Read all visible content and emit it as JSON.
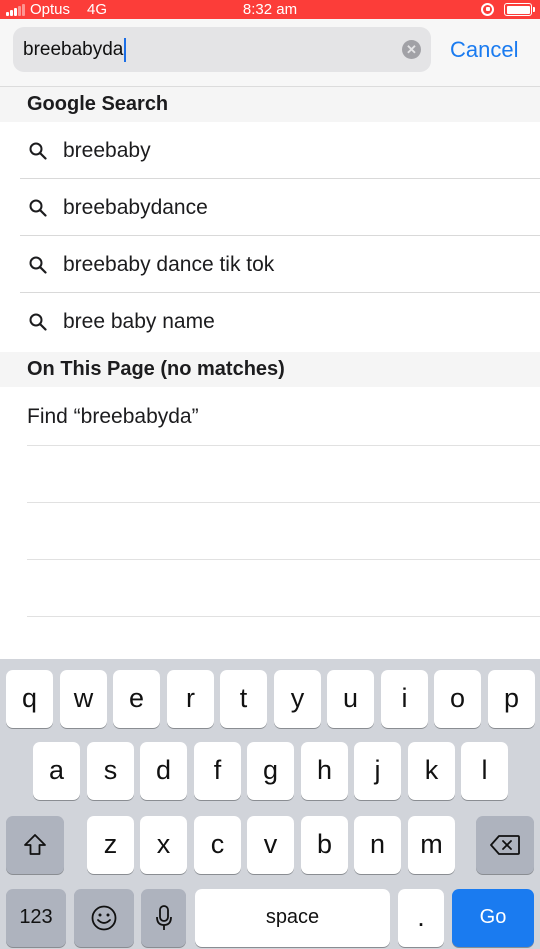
{
  "status_bar": {
    "carrier": "Optus",
    "network": "4G",
    "time": "8:32 am"
  },
  "search": {
    "query": "breebabyda",
    "cancel_label": "Cancel"
  },
  "google_section": {
    "title": "Google Search",
    "suggestions": [
      "breebaby",
      "breebabydance",
      "breebaby dance tik tok",
      "bree baby name"
    ]
  },
  "page_section": {
    "title": "On This Page (no matches)",
    "find_label": "Find “breebabyda”"
  },
  "keyboard": {
    "row1": [
      "q",
      "w",
      "e",
      "r",
      "t",
      "y",
      "u",
      "i",
      "o",
      "p"
    ],
    "row2": [
      "a",
      "s",
      "d",
      "f",
      "g",
      "h",
      "j",
      "k",
      "l"
    ],
    "row3": [
      "z",
      "x",
      "c",
      "v",
      "b",
      "n",
      "m"
    ],
    "numbers_label": "123",
    "space_label": "space",
    "period_label": ".",
    "go_label": "Go",
    "icons": {
      "shift": "shift-icon",
      "delete": "delete-icon",
      "emoji": "emoji-icon",
      "mic": "microphone-icon"
    }
  },
  "colors": {
    "status_bar": "#fc3d39",
    "accent": "#1a7bf0",
    "keyboard_bg": "#d1d4da"
  }
}
